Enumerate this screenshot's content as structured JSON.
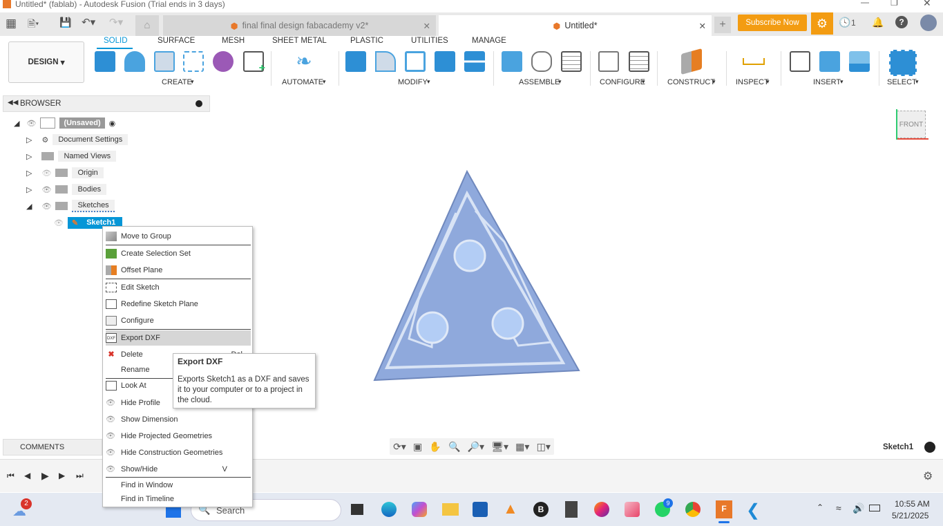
{
  "window": {
    "title": "Untitled* (fablab) - Autodesk Fusion (Trial ends in 3 days)"
  },
  "tabs": [
    {
      "label": "final final design fabacademy v2*"
    },
    {
      "label": "Untitled*"
    }
  ],
  "header": {
    "subscribe": "Subscribe Now",
    "jobs_count": "1"
  },
  "workspace": {
    "label": "DESIGN"
  },
  "ribbon_tabs": [
    "SOLID",
    "SURFACE",
    "MESH",
    "SHEET METAL",
    "PLASTIC",
    "UTILITIES",
    "MANAGE"
  ],
  "ribbon_groups": [
    "CREATE",
    "AUTOMATE",
    "MODIFY",
    "ASSEMBLE",
    "CONFIGURE",
    "CONSTRUCT",
    "INSPECT",
    "INSERT",
    "SELECT"
  ],
  "browser": {
    "title": "BROWSER",
    "root": "(Unsaved)",
    "items": [
      "Document Settings",
      "Named Views",
      "Origin",
      "Bodies",
      "Sketches"
    ],
    "selected": "Sketch1"
  },
  "context_menu": [
    "Move to Group",
    "Create Selection Set",
    "Offset Plane",
    "Edit Sketch",
    "Redefine Sketch Plane",
    "Configure",
    "Export DXF",
    "Delete",
    "Rename",
    "Look At",
    "Hide Profile",
    "Show Dimension",
    "Hide Projected Geometries",
    "Hide Construction Geometries",
    "Show/Hide",
    "Find in Window",
    "Find in Timeline"
  ],
  "menu_shortcuts": {
    "show_hide": "V",
    "delete": "Del"
  },
  "tooltip": {
    "title": "Export DXF",
    "body": "Exports Sketch1 as a DXF and saves it to your computer or to a project in the cloud."
  },
  "viewcube": {
    "face": "FRONT"
  },
  "comments": {
    "label": "COMMENTS"
  },
  "status": {
    "active": "Sketch1"
  },
  "taskbar": {
    "search": "Search",
    "time": "10:55 AM",
    "date": "5/21/2025",
    "weather_badge": "2",
    "whatsapp_badge": "9"
  }
}
